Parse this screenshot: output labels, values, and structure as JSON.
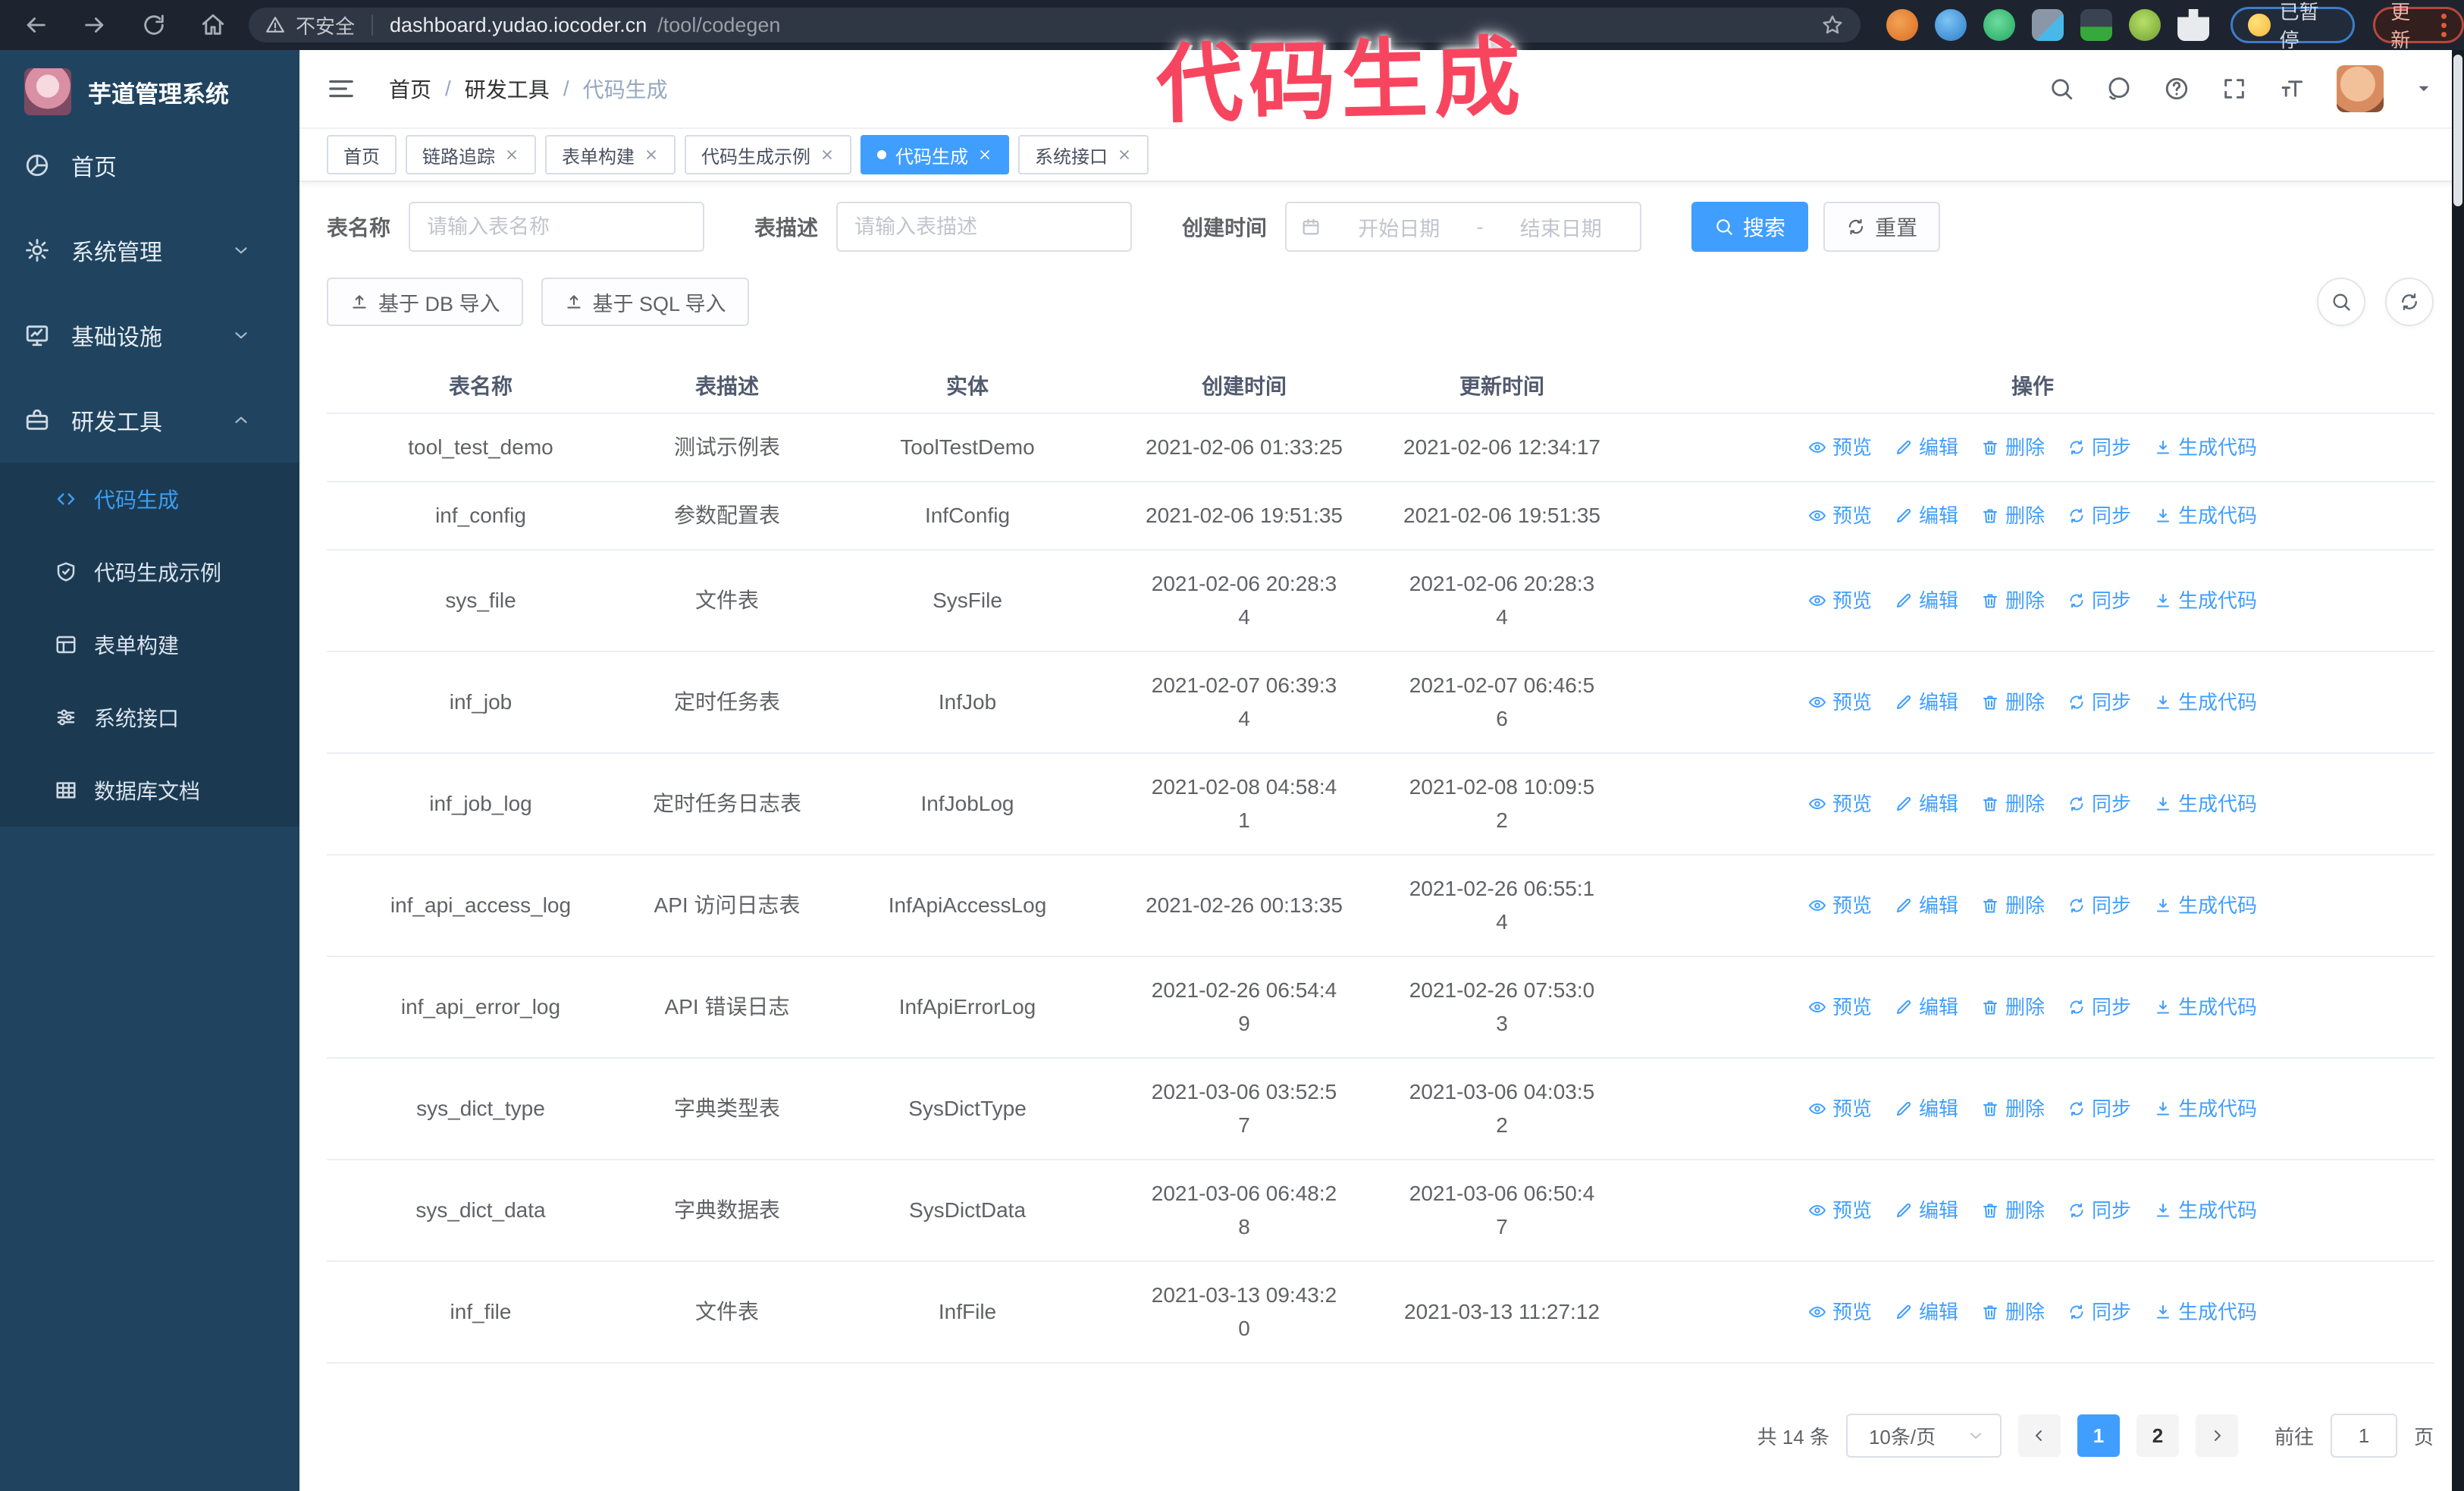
{
  "browser": {
    "security_label": "不安全",
    "url_host": "dashboard.yudao.iocoder.cn",
    "url_path": "/tool/codegen",
    "paused_badge": "已暂停",
    "update_label": "更新"
  },
  "annotation": {
    "text": "代码生成",
    "color": "#f8455f"
  },
  "sidebar": {
    "app_title": "芋道管理系统",
    "items": [
      {
        "label": "首页",
        "icon": "pie"
      },
      {
        "label": "系统管理",
        "icon": "gear",
        "chevron": "down"
      },
      {
        "label": "基础设施",
        "icon": "monitor",
        "chevron": "down"
      },
      {
        "label": "研发工具",
        "icon": "toolbox",
        "chevron": "up"
      }
    ],
    "submenu": [
      {
        "label": "代码生成",
        "icon": "code",
        "active": true
      },
      {
        "label": "代码生成示例",
        "icon": "shield"
      },
      {
        "label": "表单构建",
        "icon": "form"
      },
      {
        "label": "系统接口",
        "icon": "sliders"
      },
      {
        "label": "数据库文档",
        "icon": "dbdoc"
      }
    ]
  },
  "header": {
    "breadcrumb": [
      "首页",
      "研发工具",
      "代码生成"
    ]
  },
  "tabs": [
    {
      "label": "首页",
      "closable": false,
      "active": false
    },
    {
      "label": "链路追踪",
      "closable": true,
      "active": false
    },
    {
      "label": "表单构建",
      "closable": true,
      "active": false
    },
    {
      "label": "代码生成示例",
      "closable": true,
      "active": false
    },
    {
      "label": "代码生成",
      "closable": true,
      "active": true
    },
    {
      "label": "系统接口",
      "closable": true,
      "active": false
    }
  ],
  "filters": {
    "name_label": "表名称",
    "name_placeholder": "请输入表名称",
    "desc_label": "表描述",
    "desc_placeholder": "请输入表描述",
    "time_label": "创建时间",
    "start_placeholder": "开始日期",
    "separator": "-",
    "end_placeholder": "结束日期",
    "search_label": "搜索",
    "reset_label": "重置"
  },
  "toolbar": {
    "import_db_label": "基于 DB 导入",
    "import_sql_label": "基于 SQL 导入"
  },
  "table": {
    "columns": [
      "表名称",
      "表描述",
      "实体",
      "创建时间",
      "更新时间",
      "操作"
    ],
    "action_labels": [
      "预览",
      "编辑",
      "删除",
      "同步",
      "生成代码"
    ],
    "rows": [
      {
        "name": "tool_test_demo",
        "desc": "测试示例表",
        "entity": "ToolTestDemo",
        "created": "2021-02-06 01:33:25",
        "updated": "2021-02-06 12:34:17"
      },
      {
        "name": "inf_config",
        "desc": "参数配置表",
        "entity": "InfConfig",
        "created": "2021-02-06 19:51:35",
        "updated": "2021-02-06 19:51:35"
      },
      {
        "name": "sys_file",
        "desc": "文件表",
        "entity": "SysFile",
        "created": "2021-02-06 20:28:3\n4",
        "updated": "2021-02-06 20:28:3\n4"
      },
      {
        "name": "inf_job",
        "desc": "定时任务表",
        "entity": "InfJob",
        "created": "2021-02-07 06:39:3\n4",
        "updated": "2021-02-07 06:46:5\n6"
      },
      {
        "name": "inf_job_log",
        "desc": "定时任务日志表",
        "entity": "InfJobLog",
        "created": "2021-02-08 04:58:4\n1",
        "updated": "2021-02-08 10:09:5\n2"
      },
      {
        "name": "inf_api_access_log",
        "desc": "API 访问日志表",
        "entity": "InfApiAccessLog",
        "created": "2021-02-26 00:13:35",
        "updated": "2021-02-26 06:55:1\n4"
      },
      {
        "name": "inf_api_error_log",
        "desc": "API 错误日志",
        "entity": "InfApiErrorLog",
        "created": "2021-02-26 06:54:4\n9",
        "updated": "2021-02-26 07:53:0\n3"
      },
      {
        "name": "sys_dict_type",
        "desc": "字典类型表",
        "entity": "SysDictType",
        "created": "2021-03-06 03:52:5\n7",
        "updated": "2021-03-06 04:03:5\n2"
      },
      {
        "name": "sys_dict_data",
        "desc": "字典数据表",
        "entity": "SysDictData",
        "created": "2021-03-06 06:48:2\n8",
        "updated": "2021-03-06 06:50:4\n7"
      },
      {
        "name": "inf_file",
        "desc": "文件表",
        "entity": "InfFile",
        "created": "2021-03-13 09:43:2\n0",
        "updated": "2021-03-13 11:27:12"
      }
    ]
  },
  "pagination": {
    "total": "共 14 条",
    "page_size": "10条/页",
    "pages": [
      "1",
      "2"
    ],
    "active_page": "1",
    "goto_label": "前往",
    "goto_value": "1",
    "goto_unit": "页"
  }
}
